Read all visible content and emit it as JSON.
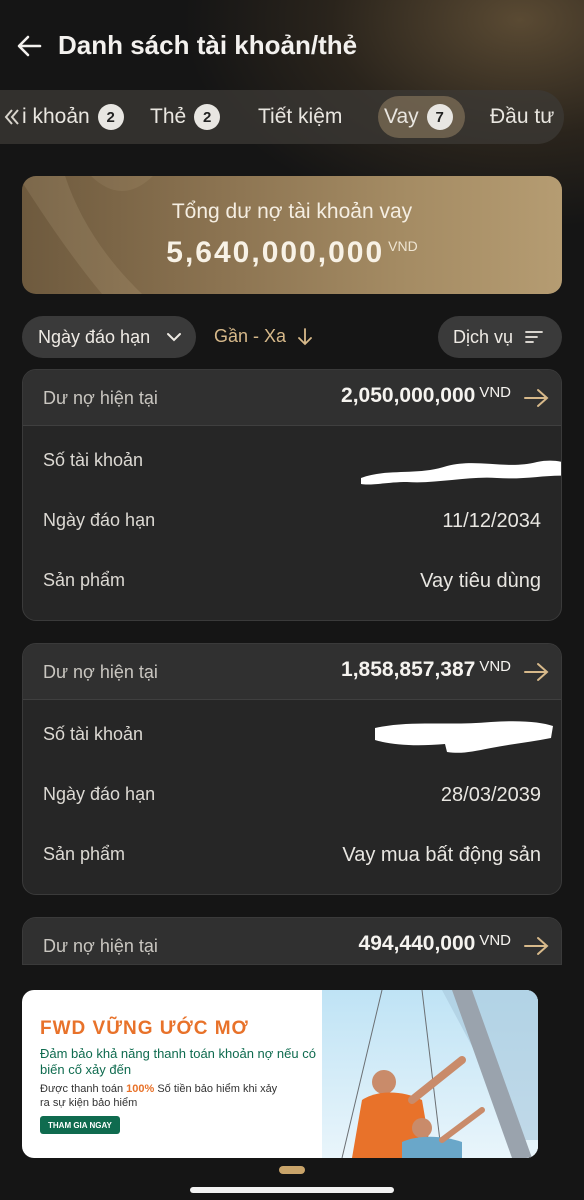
{
  "header": {
    "title": "Danh sách tài khoản/thẻ"
  },
  "tabs": [
    {
      "label": "i khoản",
      "badge": "2"
    },
    {
      "label": "Thẻ",
      "badge": "2"
    },
    {
      "label": "Tiết kiệm"
    },
    {
      "label": "Vay",
      "badge": "7",
      "active": true
    },
    {
      "label": "Đầu tư"
    }
  ],
  "summary": {
    "label": "Tổng dư nợ tài khoản vay",
    "amount": "5,640,000,000",
    "currency": "VND"
  },
  "filters": {
    "sort_field": "Ngày đáo hạn",
    "sort_order": "Gần - Xa",
    "service": "Dịch vụ"
  },
  "loans": [
    {
      "head_label": "Dư nợ hiện tại",
      "amount": "2,050,000,000",
      "currency": "VND",
      "rows": [
        {
          "label": "Số tài khoản",
          "value": ""
        },
        {
          "label": "Ngày đáo hạn",
          "value": "11/12/2034"
        },
        {
          "label": "Sản phẩm",
          "value": "Vay tiêu dùng"
        }
      ]
    },
    {
      "head_label": "Dư nợ hiện tại",
      "amount": "1,858,857,387",
      "currency": "VND",
      "rows": [
        {
          "label": "Số tài khoản",
          "value": ""
        },
        {
          "label": "Ngày đáo hạn",
          "value": "28/03/2039"
        },
        {
          "label": "Sản phẩm",
          "value": "Vay mua bất động sản"
        }
      ]
    },
    {
      "head_label": "Dư nợ hiện tại",
      "amount": "494,440,000",
      "currency": "VND"
    }
  ],
  "ad": {
    "title": "FWD VỮNG ƯỚC MƠ",
    "line1": "Đảm bảo khả năng thanh toán khoản nợ nếu có biến cố xảy đến",
    "line2_pre": "Được thanh toán ",
    "line2_pct": "100%",
    "line2_post": " Số tiền bảo hiểm khi xảy ra sự kiện bảo hiểm",
    "button": "THAM GIA NGAY"
  },
  "colors": {
    "accent": "#d7b98a",
    "summary_gold": "#a48b63",
    "ad_orange": "#e8722a",
    "ad_green": "#0f6b4f"
  }
}
